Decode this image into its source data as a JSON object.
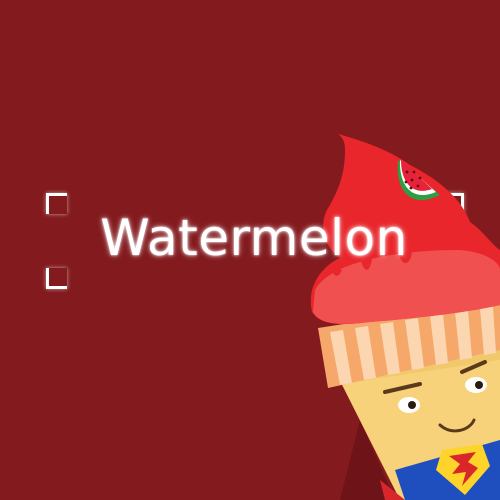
{
  "title": "Watermelon",
  "colors": {
    "background": "#831a1e",
    "ice_cream": "#e8262b",
    "ice_cream_light": "#f04a4a",
    "cone": "#f5a86a",
    "cone_stripe": "#fbd6b0",
    "face": "#f7d27a",
    "watermelon_flesh": "#e8223a",
    "watermelon_rind": "#2e9e45",
    "suit_blue": "#1f4fbf",
    "emblem_yellow": "#ffd42a"
  },
  "icons": [
    "watermelon-slice-icon",
    "superhero-emblem-icon"
  ]
}
